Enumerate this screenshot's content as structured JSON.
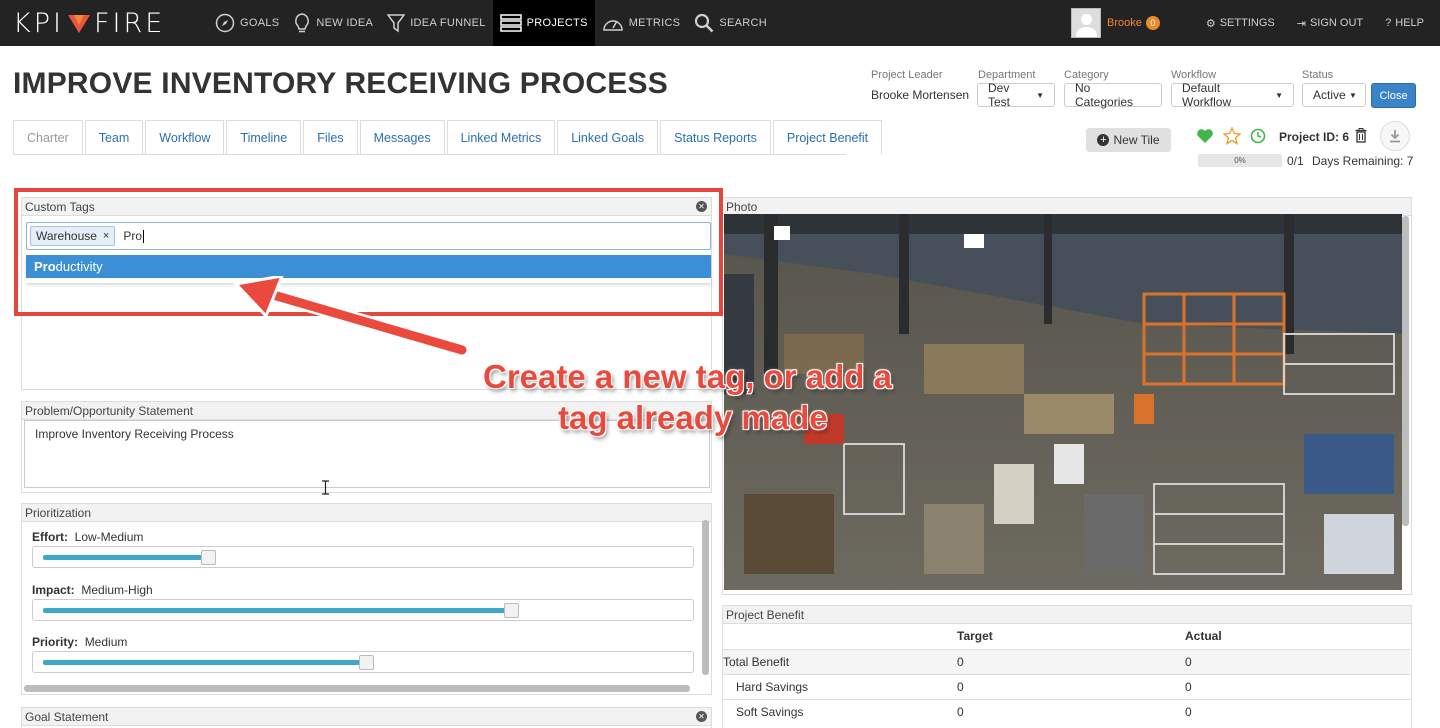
{
  "app": {
    "logo_left": "KPI",
    "logo_right": "FIRE",
    "nav": [
      {
        "label": "GOALS",
        "icon": "compass-icon"
      },
      {
        "label": "NEW IDEA",
        "icon": "lightbulb-icon"
      },
      {
        "label": "IDEA FUNNEL",
        "icon": "funnel-icon"
      },
      {
        "label": "PROJECTS",
        "icon": "projects-icon"
      },
      {
        "label": "METRICS",
        "icon": "gauge-icon"
      },
      {
        "label": "SEARCH",
        "icon": "search-icon"
      }
    ],
    "active_nav": "PROJECTS",
    "user_name": "Brooke",
    "user_badge": "0",
    "settings_label": "SETTINGS",
    "signout_label": "SIGN OUT",
    "help_label": "HELP"
  },
  "project": {
    "title": "IMPROVE INVENTORY RECEIVING PROCESS",
    "leader_label": "Project Leader",
    "leader_value": "Brooke Mortensen",
    "department_label": "Department",
    "department_value": "Dev Test",
    "category_label": "Category",
    "category_value": "No Categories",
    "workflow_label": "Workflow",
    "workflow_value": "Default Workflow",
    "status_label": "Status",
    "status_value": "Active",
    "close_label": "Close",
    "new_tile_label": "New Tile",
    "project_id_label": "Project ID: 6",
    "progress_label": "0%",
    "progress_fraction": 0,
    "progress_count": "0/1",
    "days_remaining": "Days Remaining: 7"
  },
  "tabs": [
    "Charter",
    "Team",
    "Workflow",
    "Timeline",
    "Files",
    "Messages",
    "Linked Metrics",
    "Linked Goals",
    "Status Reports",
    "Project Benefit"
  ],
  "active_tab": "Charter",
  "custom_tags": {
    "title": "Custom Tags",
    "chip": "Warehouse",
    "chip_remove": "×",
    "typed": "Pro",
    "suggestion_match": "Pro",
    "suggestion_rest": "ductivity"
  },
  "problem": {
    "title": "Problem/Opportunity Statement",
    "text": "Improve Inventory Receiving Process"
  },
  "prioritization": {
    "title": "Prioritization",
    "sliders": [
      {
        "label": "Effort:",
        "value": "Low-Medium",
        "level": 0.25
      },
      {
        "label": "Impact:",
        "value": "Medium-High",
        "level": 0.73
      },
      {
        "label": "Priority:",
        "value": "Medium",
        "level": 0.5
      }
    ]
  },
  "goal_statement": {
    "title": "Goal Statement"
  },
  "photo": {
    "title": "Photo"
  },
  "benefit": {
    "title": "Project Benefit",
    "headers": [
      "",
      "Target",
      "Actual"
    ],
    "rows": [
      {
        "name": "Total Benefit",
        "target": "0",
        "actual": "0"
      },
      {
        "name": "Hard Savings",
        "target": "0",
        "actual": "0"
      },
      {
        "name": "Soft Savings",
        "target": "0",
        "actual": "0"
      }
    ]
  },
  "annotation": {
    "line1": "Create a new tag, or add a",
    "line2": "tag already made",
    "color": "#ea4a3d"
  }
}
